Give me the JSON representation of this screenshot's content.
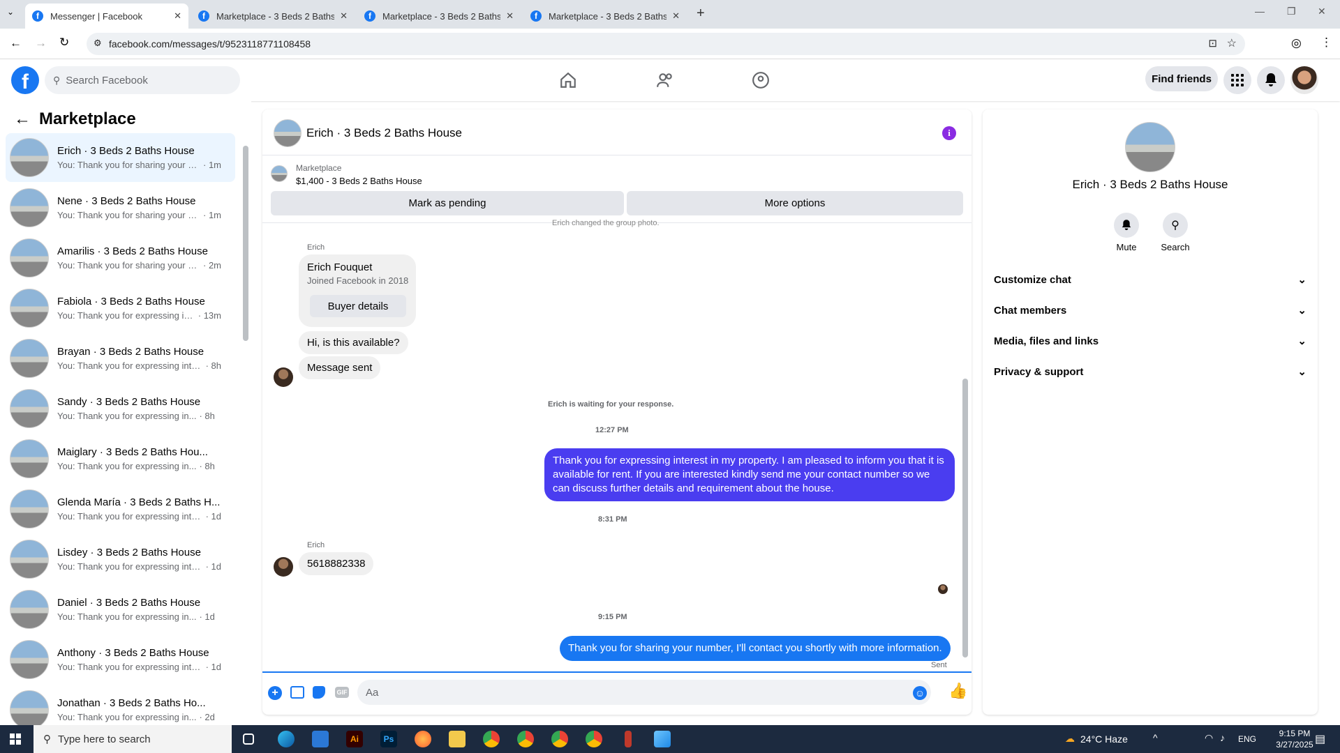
{
  "browser": {
    "tabs": [
      {
        "title": "Messenger | Facebook",
        "active": true
      },
      {
        "title": "Marketplace - 3 Beds 2 Baths H",
        "active": false
      },
      {
        "title": "Marketplace - 3 Beds 2 Baths H",
        "active": false
      },
      {
        "title": "Marketplace - 3 Beds 2 Baths H",
        "active": false
      }
    ],
    "url": "facebook.com/messages/t/9523118771108458"
  },
  "header": {
    "search_placeholder": "Search Facebook",
    "find_friends": "Find friends"
  },
  "sidebar": {
    "title": "Marketplace",
    "conversations": [
      {
        "name": "Erich · 3 Beds 2 Baths House",
        "preview": "You: Thank you for sharing your nu...",
        "time": "· 1m",
        "selected": true
      },
      {
        "name": "Nene · 3 Beds 2 Baths House",
        "preview": "You: Thank you for sharing your nu...",
        "time": "· 1m"
      },
      {
        "name": "Amarilis · 3 Beds 2 Baths House",
        "preview": "You: Thank you for sharing your nu...",
        "time": "· 2m"
      },
      {
        "name": "Fabiola · 3 Beds 2 Baths House",
        "preview": "You: Thank you for expressing int...",
        "time": "· 13m"
      },
      {
        "name": "Brayan · 3 Beds 2 Baths House",
        "preview": "You: Thank you for expressing inter...",
        "time": "· 8h"
      },
      {
        "name": "Sandy · 3 Beds 2 Baths House",
        "preview": "You: Thank you for expressing in...",
        "time": "· 8h"
      },
      {
        "name": "Maiglary · 3 Beds 2 Baths Hou...",
        "preview": "You: Thank you for expressing in...",
        "time": "· 8h"
      },
      {
        "name": "Glenda María · 3 Beds 2 Baths H...",
        "preview": "You: Thank you for expressing inter...",
        "time": "· 1d"
      },
      {
        "name": "Lisdey · 3 Beds 2 Baths House",
        "preview": "You: Thank you for expressing inter...",
        "time": "· 1d"
      },
      {
        "name": "Daniel · 3 Beds 2 Baths House",
        "preview": "You: Thank you for expressing in...",
        "time": "· 1d"
      },
      {
        "name": "Anthony · 3 Beds 2 Baths House",
        "preview": "You: Thank you for expressing inter...",
        "time": "· 1d"
      },
      {
        "name": "Jonathan · 3 Beds 2 Baths Ho...",
        "preview": "You: Thank you for expressing in...",
        "time": "· 2d"
      }
    ]
  },
  "chat": {
    "title": "Erich · 3 Beds 2 Baths House",
    "listing_source": "Marketplace",
    "listing_detail": "$1,400 - 3 Beds 2 Baths House",
    "mark_pending": "Mark as pending",
    "more_options": "More options",
    "group_photo_note": "Erich changed the group photo.",
    "sender_label": "Erich",
    "buyer_card": {
      "name": "Erich Fouquet",
      "joined": "Joined Facebook in 2018",
      "button": "Buyer details"
    },
    "msg_available": "Hi, is this available?",
    "msg_sent_label": "Message sent",
    "waiting_note": "Erich is waiting for your response.",
    "time_1": "12:27 PM",
    "out_msg_1": "Thank you for expressing interest in my property. I am pleased to inform you that it is available for rent. If you are interested kindly send me your contact number so we can discuss further details and requirement about the house.",
    "time_2": "8:31 PM",
    "sender_label_2": "Erich",
    "msg_number": "5618882338",
    "time_3": "9:15 PM",
    "out_msg_2": "Thank you for sharing your number, I'll contact you shortly with more information.",
    "status": "Sent",
    "composer_placeholder": "Aa"
  },
  "details": {
    "name": "Erich · 3 Beds 2 Baths House",
    "mute": "Mute",
    "search": "Search",
    "sections": [
      "Customize chat",
      "Chat members",
      "Media, files and links",
      "Privacy & support"
    ]
  },
  "taskbar": {
    "search_placeholder": "Type here to search",
    "weather": "24°C  Haze",
    "lang": "ENG",
    "time": "9:15 PM",
    "date": "3/27/2025"
  },
  "colors": {
    "brand": "#1877f2",
    "outgoing": "#4a3df0",
    "purple_info": "#8a2be2"
  }
}
